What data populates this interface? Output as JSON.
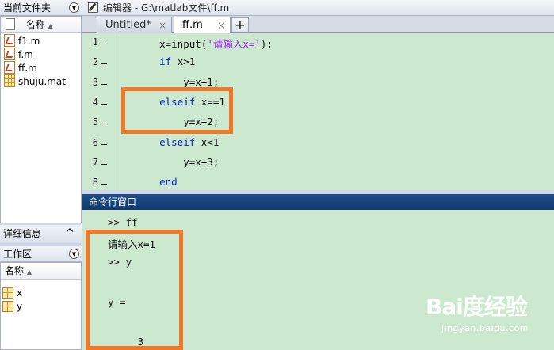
{
  "left_panel": {
    "current_folder": {
      "title": "当前文件夹",
      "column_name": "名称",
      "sort_arrow": "▲",
      "files": [
        {
          "name": "f1.m",
          "icon": "m-file-icon"
        },
        {
          "name": "f.m",
          "icon": "m-file-icon"
        },
        {
          "name": "ff.m",
          "icon": "m-file-icon"
        },
        {
          "name": "shuju.mat",
          "icon": "mat-file-icon"
        }
      ]
    },
    "details": {
      "title": "详细信息",
      "toggle": "^"
    },
    "workspace": {
      "title": "工作区",
      "column_name": "名称",
      "sort_arrow": "▲",
      "variables": [
        {
          "name": "x",
          "icon": "variable-icon"
        },
        {
          "name": "y",
          "icon": "variable-icon"
        }
      ]
    }
  },
  "editor": {
    "title": "编辑器 - G:\\matlab文件\\ff.m",
    "tabs": [
      {
        "label": "Untitled*",
        "close": "×"
      },
      {
        "label": "ff.m",
        "close": "×"
      }
    ],
    "add_tab": "+",
    "lines": [
      {
        "num": "1",
        "tokens": [
          {
            "t": "    x=input(",
            "c": ""
          },
          {
            "t": "'请输入x='",
            "c": "str"
          },
          {
            "t": ");",
            "c": ""
          }
        ]
      },
      {
        "num": "2",
        "tokens": [
          {
            "t": "    ",
            "c": ""
          },
          {
            "t": "if",
            "c": "kw"
          },
          {
            "t": " x>1",
            "c": ""
          }
        ]
      },
      {
        "num": "3",
        "tokens": [
          {
            "t": "        y=x+1;",
            "c": ""
          }
        ]
      },
      {
        "num": "4",
        "tokens": [
          {
            "t": "    ",
            "c": ""
          },
          {
            "t": "elseif",
            "c": "kw"
          },
          {
            "t": " x==1",
            "c": ""
          }
        ]
      },
      {
        "num": "5",
        "tokens": [
          {
            "t": "        y=x+2;",
            "c": ""
          }
        ]
      },
      {
        "num": "6",
        "tokens": [
          {
            "t": "    ",
            "c": ""
          },
          {
            "t": "elseif",
            "c": "kw"
          },
          {
            "t": " x<1",
            "c": ""
          }
        ]
      },
      {
        "num": "7",
        "tokens": [
          {
            "t": "        y=x+3;",
            "c": ""
          }
        ]
      },
      {
        "num": "8",
        "tokens": [
          {
            "t": "    ",
            "c": ""
          },
          {
            "t": "end",
            "c": "kw"
          }
        ]
      }
    ]
  },
  "command_window": {
    "title": "命令行窗口",
    "lines": [
      ">> ff",
      "请输入x=1",
      ">> y",
      "",
      "y =",
      "",
      "     3"
    ]
  },
  "watermark": {
    "brand": "Bai度经验",
    "sub": "jingyan.baidu.com"
  },
  "colors": {
    "code_bg": "#cce8cf",
    "highlight": "#f07828",
    "cmd_header": "#1d4d8a",
    "keyword": "#0b21c9",
    "string": "#a020f0"
  }
}
